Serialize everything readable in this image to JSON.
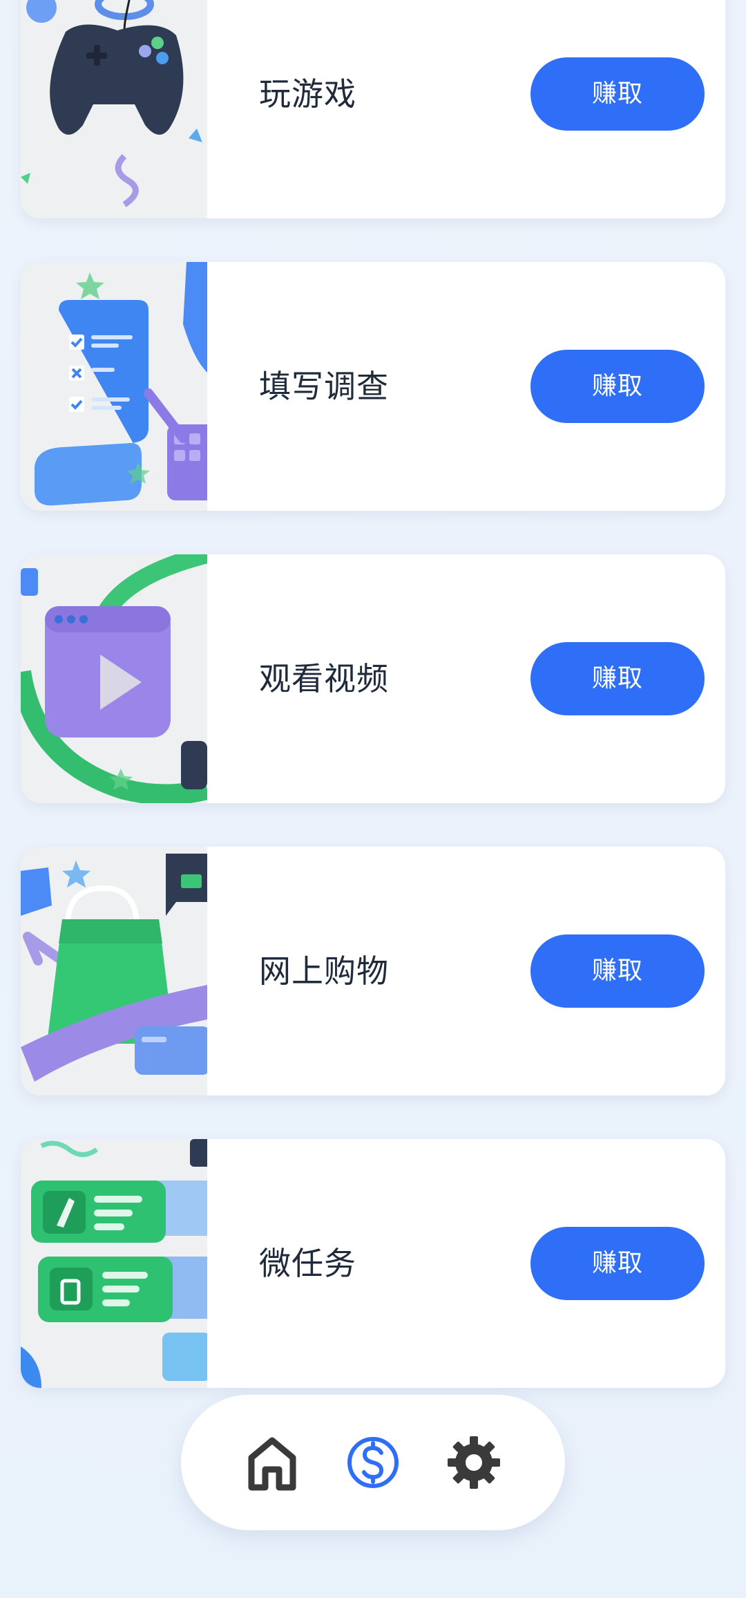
{
  "tasks": [
    {
      "title": "玩游戏",
      "button": "赚取",
      "icon": "game-controller-image"
    },
    {
      "title": "填写调查",
      "button": "赚取",
      "icon": "survey-checklist-image"
    },
    {
      "title": "观看视频",
      "button": "赚取",
      "icon": "video-player-image"
    },
    {
      "title": "网上购物",
      "button": "赚取",
      "icon": "shopping-bag-image"
    },
    {
      "title": "微任务",
      "button": "赚取",
      "icon": "micro-task-cards-image"
    }
  ],
  "nav": {
    "items": [
      {
        "name": "home",
        "icon": "home-icon",
        "active": false
      },
      {
        "name": "earn",
        "icon": "dollar-icon",
        "active": true
      },
      {
        "name": "settings",
        "icon": "gear-icon",
        "active": false
      }
    ]
  },
  "colors": {
    "accent": "#2F6EF6",
    "background": "#EAF2FB",
    "text": "#1F2A3A",
    "icon_inactive": "#3A3A3A"
  }
}
